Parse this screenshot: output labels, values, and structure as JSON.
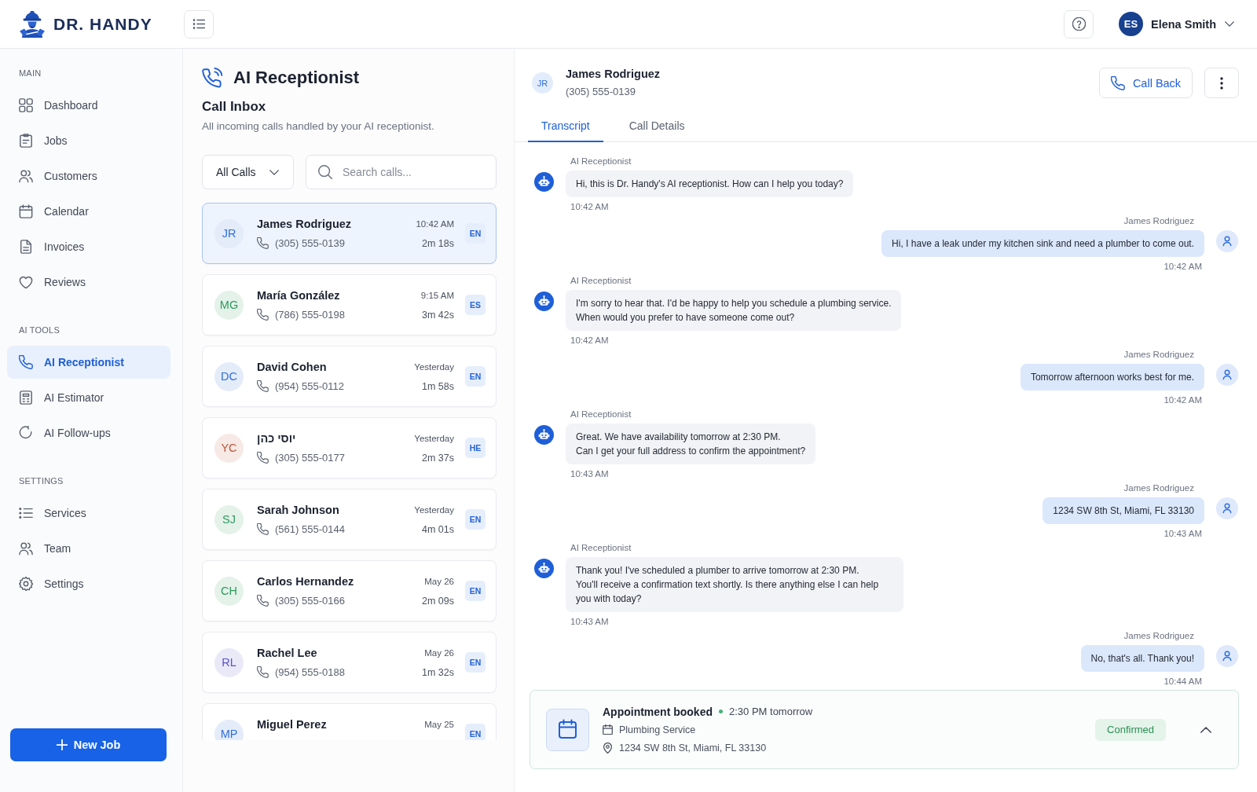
{
  "header": {
    "brand": "DR. HANDY",
    "user": {
      "initials": "ES",
      "name": "Elena Smith"
    }
  },
  "sidebar": {
    "sections": [
      {
        "title": "MAIN",
        "items": [
          {
            "label": "Dashboard",
            "selected": false
          },
          {
            "label": "Jobs",
            "selected": false
          },
          {
            "label": "Customers",
            "selected": false
          },
          {
            "label": "Calendar",
            "selected": false
          },
          {
            "label": "Invoices",
            "selected": false
          },
          {
            "label": "Reviews",
            "selected": false
          }
        ]
      },
      {
        "title": "AI TOOLS",
        "items": [
          {
            "label": "AI Receptionist",
            "selected": true
          },
          {
            "label": "AI Estimator",
            "selected": false
          },
          {
            "label": "AI Follow-ups",
            "selected": false
          }
        ]
      },
      {
        "title": "SETTINGS",
        "items": [
          {
            "label": "Services",
            "selected": false
          },
          {
            "label": "Team",
            "selected": false
          },
          {
            "label": "Settings",
            "selected": false
          }
        ]
      }
    ],
    "new_job_button": "New Job"
  },
  "inbox": {
    "title": "AI Receptionist",
    "heading": "Call Inbox",
    "subtitle": "All incoming calls handled by your AI receptionist.",
    "filter": "All Calls",
    "search": {
      "placeholder": "Search calls..."
    },
    "calls": [
      {
        "initials": "JR",
        "color": "#2f6fdb",
        "name": "James Rodriguez",
        "phone": "(305) 555-0139",
        "time": "10:42 AM",
        "duration": "2m 18s",
        "language": "EN",
        "selected": true
      },
      {
        "initials": "MG",
        "color": "#2f9a5f",
        "name": "María González",
        "phone": "(786) 555-0198",
        "time": "9:15 AM",
        "duration": "3m 42s",
        "language": "ES",
        "selected": false
      },
      {
        "initials": "DC",
        "color": "#2f6fdb",
        "name": "David Cohen",
        "phone": "(954) 555-0112",
        "time": "Yesterday",
        "duration": "1m 58s",
        "language": "EN",
        "selected": false
      },
      {
        "initials": "YC",
        "color": "#c0553a",
        "name": "יוסי כהן",
        "phone": "(305) 555-0177",
        "time": "Yesterday",
        "duration": "2m 37s",
        "language": "HE",
        "selected": false
      },
      {
        "initials": "SJ",
        "color": "#2f9a5f",
        "name": "Sarah Johnson",
        "phone": "(561) 555-0144",
        "time": "Yesterday",
        "duration": "4m 01s",
        "language": "EN",
        "selected": false
      },
      {
        "initials": "CH",
        "color": "#2f9a5f",
        "name": "Carlos Hernandez",
        "phone": "(305) 555-0166",
        "time": "May 26",
        "duration": "2m 09s",
        "language": "EN",
        "selected": false
      },
      {
        "initials": "RL",
        "color": "#5a55c8",
        "name": "Rachel Lee",
        "phone": "(954) 555-0188",
        "time": "May 26",
        "duration": "1m 32s",
        "language": "EN",
        "selected": false
      },
      {
        "initials": "MP",
        "color": "#2f6fdb",
        "name": "Miguel Perez",
        "time": "May 25",
        "language": "EN",
        "selected": false
      }
    ]
  },
  "conversation": {
    "contact": {
      "initials": "JR",
      "name": "James Rodriguez",
      "phone": "(305) 555-0139"
    },
    "call_back_button": "Call Back",
    "tabs": [
      {
        "label": "Transcript",
        "selected": true
      },
      {
        "label": "Call Details",
        "selected": false
      }
    ],
    "messages": [
      {
        "kind": "bot",
        "speaker": "AI Receptionist",
        "text": "Hi, this is Dr. Handy's AI receptionist. How can I help you today?",
        "time": "10:42 AM"
      },
      {
        "kind": "user",
        "speaker": "James Rodriguez",
        "text": "Hi, I have a leak under my kitchen sink and need a plumber to come out.",
        "time": "10:42 AM"
      },
      {
        "kind": "bot",
        "speaker": "AI Receptionist",
        "text": "I'm sorry to hear that. I'd be happy to help you schedule a plumbing service.\nWhen would you prefer to have someone come out?",
        "time": "10:42 AM"
      },
      {
        "kind": "user",
        "speaker": "James Rodriguez",
        "text": "Tomorrow afternoon works best for me.",
        "time": "10:42 AM"
      },
      {
        "kind": "bot",
        "speaker": "AI Receptionist",
        "text": "Great. We have availability tomorrow at 2:30 PM.\nCan I get your full address to confirm the appointment?",
        "time": "10:43 AM"
      },
      {
        "kind": "user",
        "speaker": "James Rodriguez",
        "text": "1234 SW 8th St, Miami, FL 33130",
        "time": "10:43 AM"
      },
      {
        "kind": "bot",
        "speaker": "AI Receptionist",
        "text": "Thank you! I've scheduled a plumber to arrive tomorrow at 2:30 PM.\nYou'll receive a confirmation text shortly. Is there anything else I can help you with today?",
        "time": "10:43 AM"
      },
      {
        "kind": "user",
        "speaker": "James Rodriguez",
        "text": "No, that's all. Thank you!",
        "time": "10:44 AM"
      }
    ],
    "appointment": {
      "title": "Appointment booked",
      "when": "2:30 PM tomorrow",
      "service": "Plumbing Service",
      "address": "1234 SW 8th St, Miami, FL 33130",
      "status": "Confirmed",
      "expanded": true
    }
  }
}
